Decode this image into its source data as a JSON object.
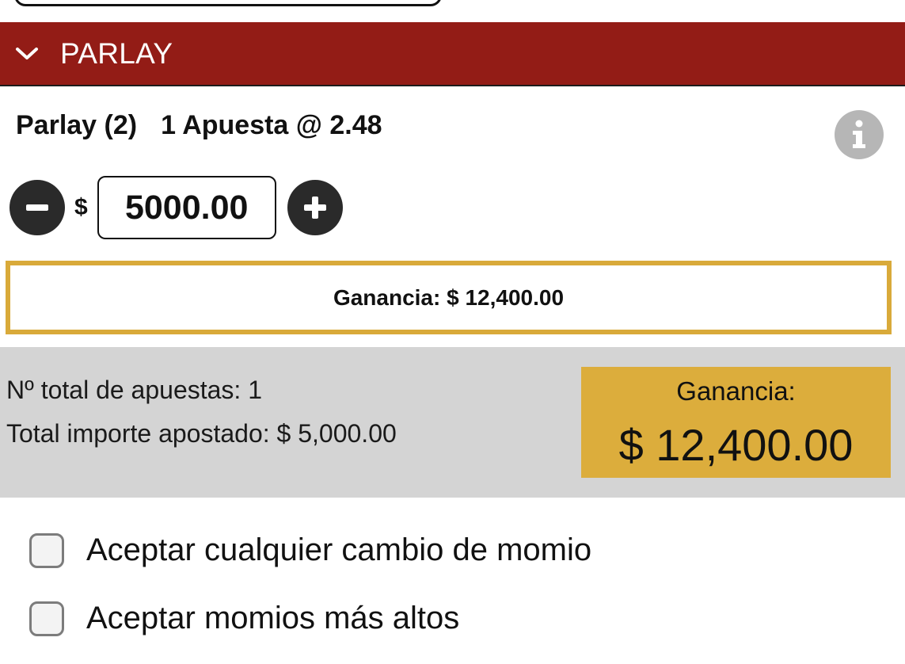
{
  "header": {
    "title": "PARLAY",
    "chevron_icon": "chevron-down-icon",
    "background": "#931c16"
  },
  "bet": {
    "type_label": "Parlay (2)",
    "bet_count_label": "1 Apuesta @ 2.48",
    "info_icon": "info-icon",
    "stake": {
      "currency": "$",
      "value": "5000.00",
      "decrease_icon": "minus-icon",
      "increase_icon": "plus-icon"
    },
    "ganancia_label": "Ganancia: $ 12,400.00",
    "ganancia_border_color": "#d9aa3a"
  },
  "summary": {
    "total_bets": "Nº total de apuestas: 1",
    "total_staked": "Total importe apostado: $ 5,000.00",
    "payout_label": "Ganancia:",
    "payout_value": "$ 12,400.00",
    "payout_color": "#dcad3c"
  },
  "options": [
    {
      "label": "Aceptar cualquier cambio de momio",
      "checked": false
    },
    {
      "label": "Aceptar momios más altos",
      "checked": false
    }
  ]
}
